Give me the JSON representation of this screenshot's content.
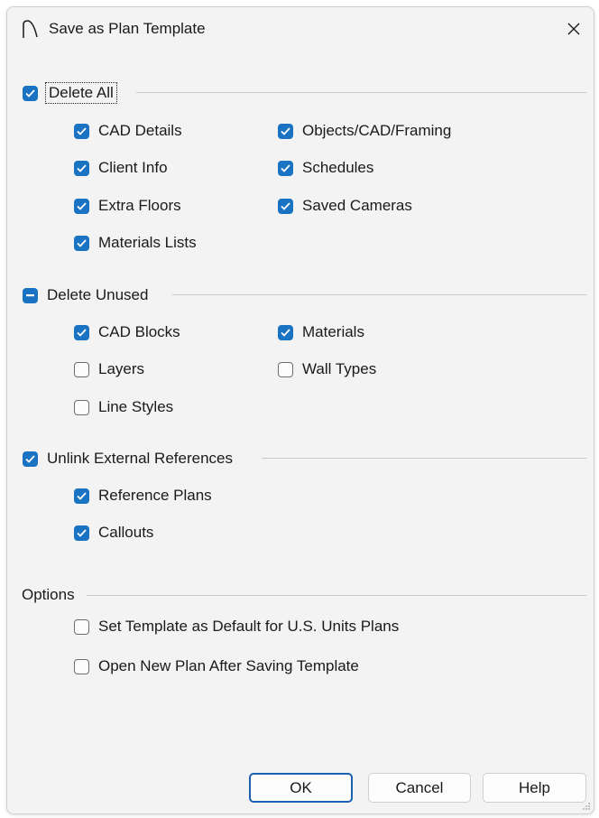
{
  "window": {
    "title": "Save as Plan Template"
  },
  "delete_all": {
    "label": "Delete All",
    "state": "checked",
    "items": {
      "cad_details": {
        "label": "CAD Details",
        "checked": true
      },
      "objects_cad_framing": {
        "label": "Objects/CAD/Framing",
        "checked": true
      },
      "client_info": {
        "label": "Client Info",
        "checked": true
      },
      "schedules": {
        "label": "Schedules",
        "checked": true
      },
      "extra_floors": {
        "label": "Extra Floors",
        "checked": true
      },
      "saved_cameras": {
        "label": "Saved Cameras",
        "checked": true
      },
      "materials_lists": {
        "label": "Materials Lists",
        "checked": true
      }
    }
  },
  "delete_unused": {
    "label": "Delete Unused",
    "state": "indeterminate",
    "items": {
      "cad_blocks": {
        "label": "CAD Blocks",
        "checked": true
      },
      "materials": {
        "label": "Materials",
        "checked": true
      },
      "layers": {
        "label": "Layers",
        "checked": false
      },
      "wall_types": {
        "label": "Wall Types",
        "checked": false
      },
      "line_styles": {
        "label": "Line Styles",
        "checked": false
      }
    }
  },
  "unlink_external": {
    "label": "Unlink External References",
    "state": "checked",
    "items": {
      "reference_plans": {
        "label": "Reference Plans",
        "checked": true
      },
      "callouts": {
        "label": "Callouts",
        "checked": true
      }
    }
  },
  "options": {
    "label": "Options",
    "items": {
      "set_default": {
        "label": "Set Template as Default for U.S. Units Plans",
        "checked": false
      },
      "open_new_plan": {
        "label": "Open New Plan After Saving Template",
        "checked": false
      }
    }
  },
  "buttons": {
    "ok": "OK",
    "cancel": "Cancel",
    "help": "Help"
  },
  "colors": {
    "accent": "#1a73c2",
    "window_bg": "#f3f3f3",
    "default_button_border": "#1a5fb0"
  }
}
